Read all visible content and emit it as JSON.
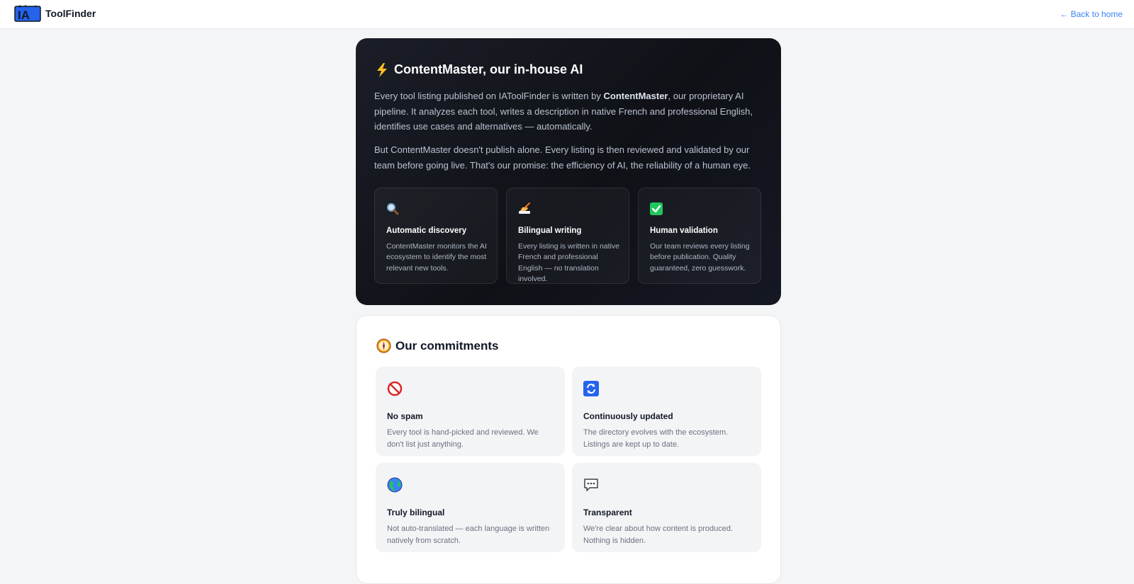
{
  "header": {
    "brand": "ToolFinder",
    "logo_icon": "ia-logo-icon",
    "back_link": "← Back to home",
    "accent_color": "#3b82f6"
  },
  "ai_section": {
    "title": "ContentMaster, our in-house AI",
    "title_icon": "lightning-bolt-icon",
    "paragraph1_before": "Every tool listing published on IAToolFinder is written by ",
    "paragraph1_strong": "ContentMaster",
    "paragraph1_after": ", our proprietary AI pipeline. It analyzes each tool, writes a description in native French and professional English, identifies use cases and alternatives — automatically.",
    "paragraph2": "But ContentMaster doesn't publish alone. Every listing is then reviewed and validated by our team before going live. That's our promise: the efficiency of AI, the reliability of a human eye.",
    "features": [
      {
        "icon": "magnifier-icon",
        "title": "Automatic discovery",
        "desc": "ContentMaster monitors the AI ecosystem to identify the most relevant new tools."
      },
      {
        "icon": "writing-hand-icon",
        "title": "Bilingual writing",
        "desc": "Every listing is written in native French and professional English — no translation involved."
      },
      {
        "icon": "check-mark-icon",
        "title": "Human validation",
        "desc": "Our team reviews every listing before publication. Quality guaranteed, zero guesswork."
      }
    ]
  },
  "commitments": {
    "title": "Our commitments",
    "title_icon": "compass-icon",
    "items": [
      {
        "icon": "no-entry-icon",
        "title": "No spam",
        "desc": "Every tool is hand-picked and reviewed. We don't list just anything."
      },
      {
        "icon": "refresh-icon",
        "title": "Continuously updated",
        "desc": "The directory evolves with the ecosystem. Listings are kept up to date."
      },
      {
        "icon": "globe-icon",
        "title": "Truly bilingual",
        "desc": "Not auto-translated — each language is written natively from scratch."
      },
      {
        "icon": "speech-bubble-icon",
        "title": "Transparent",
        "desc": "We're clear about how content is produced. Nothing is hidden."
      }
    ]
  }
}
